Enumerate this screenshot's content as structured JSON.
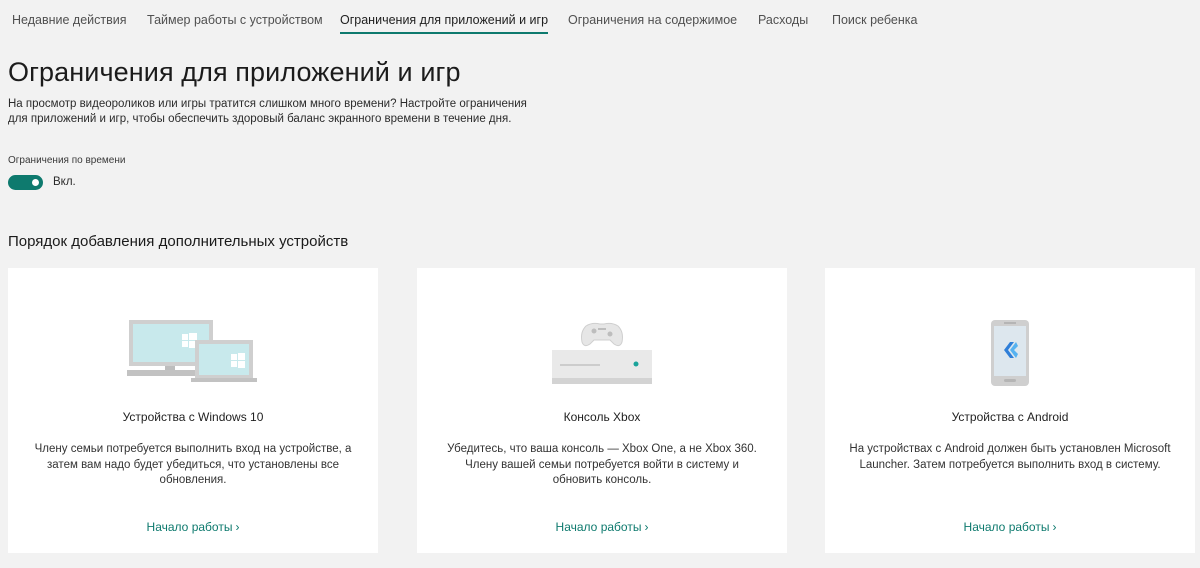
{
  "tabs": [
    {
      "label": "Недавние действия"
    },
    {
      "label": "Таймер работы с устройством"
    },
    {
      "label": "Ограничения для приложений и игр",
      "active": true
    },
    {
      "label": "Ограничения на содержимое"
    },
    {
      "label": "Расходы"
    },
    {
      "label": "Поиск ребенка"
    }
  ],
  "page": {
    "title": "Ограничения для приложений и игр",
    "description": "На просмотр видеороликов или игры тратится слишком много времени? Настройте ограничения для приложений и игр, чтобы обеспечить здоровый баланс экранного времени в течение дня.",
    "time_limits_label": "Ограничения по времени",
    "toggle_state": "Вкл."
  },
  "section": {
    "title": "Порядок добавления дополнительных устройств"
  },
  "cards": [
    {
      "icon": "windows-devices-icon",
      "title": "Устройства с Windows 10",
      "description": "Члену семьи потребуется выполнить вход на устройстве, а затем вам надо будет убедиться, что установлены все обновления.",
      "link": "Начало работы"
    },
    {
      "icon": "xbox-console-icon",
      "title": "Консоль Xbox",
      "description": "Убедитесь, что ваша консоль — Xbox One, а не Xbox 360. Члену вашей семьи потребуется войти в систему и обновить консоль.",
      "link": "Начало работы"
    },
    {
      "icon": "android-phone-icon",
      "title": "Устройства с Android",
      "description": "На устройствах с Android должен быть установлен Microsoft Launcher. Затем потребуется выполнить вход в систему.",
      "link": "Начало работы"
    }
  ],
  "colors": {
    "accent": "#0e7a6e",
    "background": "#f2f2f2",
    "card": "#ffffff"
  },
  "chevron_glyph": "›"
}
